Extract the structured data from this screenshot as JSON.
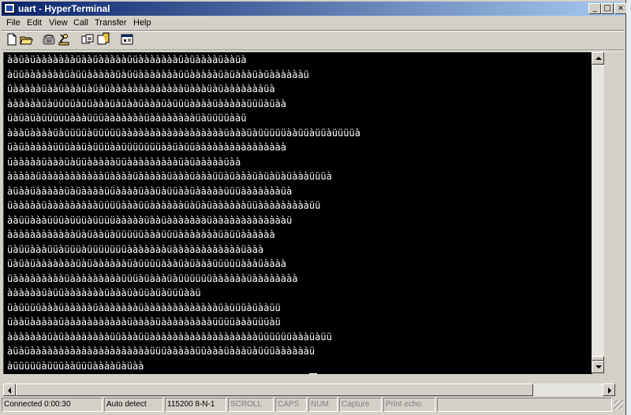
{
  "window": {
    "title": "uart - HyperTerminal",
    "controls": {
      "minimize": "_",
      "maximize": "□",
      "close": "×"
    }
  },
  "menu": [
    "File",
    "Edit",
    "View",
    "Call",
    "Transfer",
    "Help"
  ],
  "toolbar": [
    "new-document-icon",
    "open-folder-icon",
    "phone-icon",
    "disconnect-icon",
    "send-file-icon",
    "receive-file-icon",
    "properties-icon"
  ],
  "terminal": {
    "lines": [
      "ààüàüàààààààüààüàààààüüàààààààüàüààààüààüà",
      "àüüàààààààüàüüàààààüàüüàààààààüüàààààüàüàààüàüààààààü",
      "üàààààüààüàààüàüàüàààààààààààààüàààüàüàààààààüà",
      "ààààààüàüüüüàüüàààüàüààüàààüàüüüààààüàààààüüüàüàà",
      "üàüàüàüüüüüàààüüüàààààààüààààààààüàüüüüààü",
      "àààüààààüàüüüüàüüüüüààààààààààààààààààüàààüàüüüüüààüüàüüàüüüüà",
      "üàüàààààüüüààüàüüüààüüüüüüüààüàüüàààààààààààààààà",
      "üàààààüàààüàüüàààààüüàààààààààüàüàààààüàà",
      "àààààüàààààààààààüààààüàààààüàààüàààüüàüàààüàüàüàüàààüüüà",
      "àüààüàààààüàüààààüüààààüààüàüüààüàààààüüüàààààààüà",
      "üàààààüàààààààààüüüüàààüüààààààüàüàüààààààüüàààààààààüü",
      "ààüüàààüüüàüüüàüüüüàààààüààüàààààààüàààààààààààààü",
      "ààààààààààààüàüààüàüüüüüàààüüüàààààààüàüüàààààà",
      "üàüüàààüüàüüüàüüüüüüüàààààààüààààààààààààüààà",
      "üàüàüàààààààüàüààààààüàüüüüàààüàüàààüüüüüàààüàààà",
      "üàààààààààüàààààààààüüüàüàààüàüüüüüüààààààüàààààààà",
      "ààààààüàüüàààààààüàààüàüüàüàüüüààü",
      "üàüüüüàààüàààààüàààààààüàààààààààààààüàüüüàüààüü",
      "üààüàààààüàààààààààààüààààüàààààààààüüüüàààüüüàü",
      "àààààààüàüààààààààüüàààüüàààààààààààààààààààüüüüüüàààüàüü",
      "àüàüàààààààààààààààààààààüüüàààààüüàààüàààüàüüüààààààü",
      "àüüüüüàüüüààüüüààààüàüàà"
    ]
  },
  "status": {
    "connection": "Connected 0:00:30",
    "detect": "Auto detect",
    "port_settings": "115200 8-N-1",
    "scroll": "SCROLL",
    "caps": "CAPS",
    "num": "NUM",
    "capture": "Capture",
    "print_echo": "Print echo"
  }
}
